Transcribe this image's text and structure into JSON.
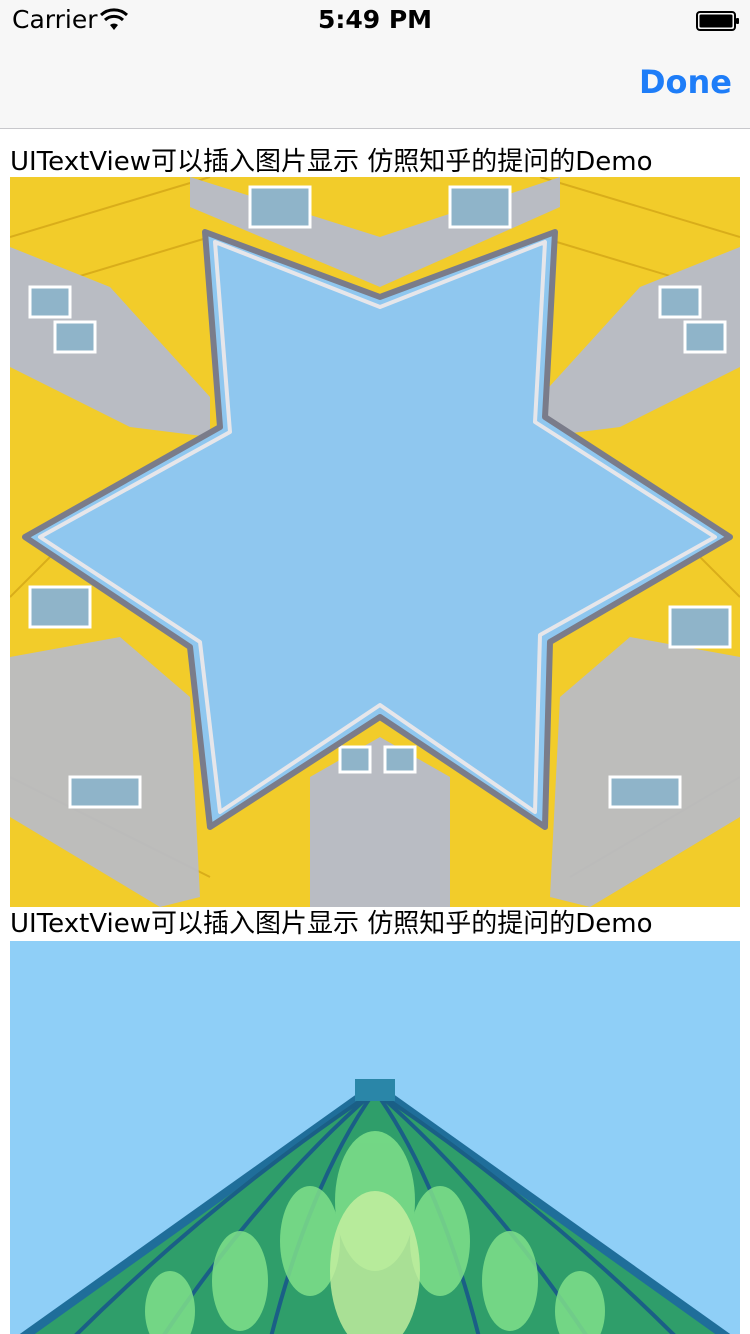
{
  "status_bar": {
    "carrier": "Carrier",
    "time": "5:49 PM",
    "wifi_icon": "wifi-icon",
    "battery_icon": "battery-icon"
  },
  "nav_bar": {
    "done_label": "Done",
    "accent_color": "#1e7df8"
  },
  "content": {
    "lines": [
      "UITextView可以插入图片显示 仿照知乎的提问的Demo",
      "UITextView可以插入图片显示 仿照知乎的提问的Demo"
    ]
  }
}
